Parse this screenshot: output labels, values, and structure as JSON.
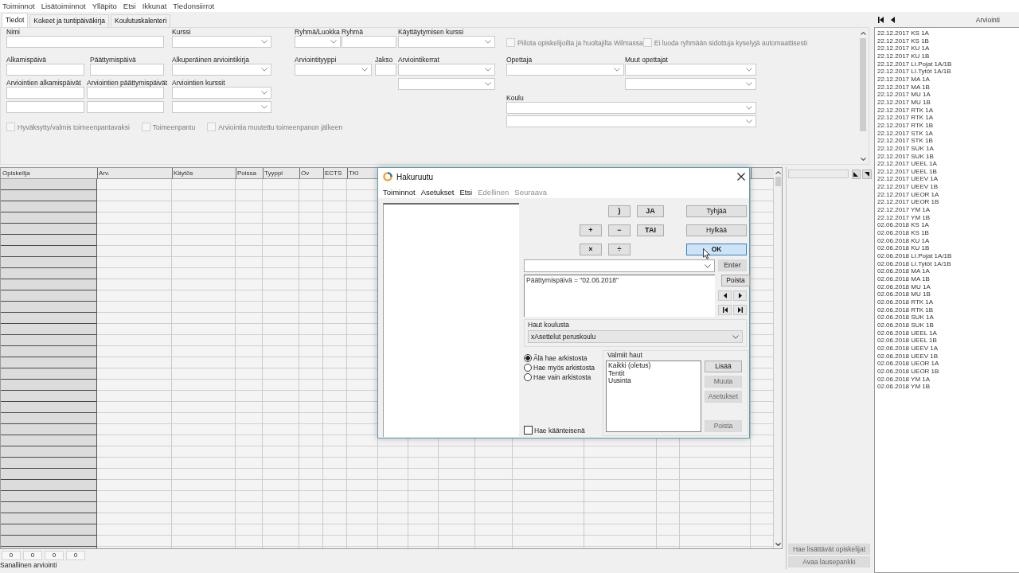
{
  "menu_bar": [
    "Toiminnot",
    "Lisätoiminnot",
    "Ylläpito",
    "Etsi",
    "Ikkunat",
    "Tiedonsiirrot"
  ],
  "tabs": [
    {
      "label": "Tiedot",
      "selected": true
    },
    {
      "label": "Kokeet ja tuntipäiväkirja",
      "selected": false
    },
    {
      "label": "Koulutuskalenteri",
      "selected": false
    }
  ],
  "form": {
    "fields": [
      {
        "label": "Nimi",
        "inputs": [
          {
            "kind": "text"
          }
        ]
      },
      {
        "label": "Kurssi",
        "inputs": [
          {
            "kind": "combo"
          }
        ]
      },
      {
        "label": "Ryhmä/Luokka",
        "inputs": [
          {
            "kind": "combo"
          }
        ]
      },
      {
        "label": "Ryhmä",
        "inputs": [
          {
            "kind": "text"
          }
        ]
      },
      {
        "label": "Käyttäytymisen kurssi",
        "inputs": [
          {
            "kind": "combo"
          }
        ]
      },
      {
        "label": "Alkamispäivä",
        "inputs": [
          {
            "kind": "text"
          }
        ]
      },
      {
        "label": "Päättymispäivä",
        "inputs": [
          {
            "kind": "text"
          }
        ]
      },
      {
        "label": "Alkuperäinen arviointikirja",
        "inputs": [
          {
            "kind": "combo"
          }
        ]
      },
      {
        "label": "Arviointityyppi",
        "inputs": [
          {
            "kind": "combo"
          }
        ]
      },
      {
        "label": "Jakso",
        "inputs": [
          {
            "kind": "text"
          }
        ]
      },
      {
        "label": "Arviointikerrat",
        "inputs": [
          {
            "kind": "combo"
          },
          {
            "kind": "combo"
          }
        ]
      },
      {
        "label": "Opettaja",
        "inputs": [
          {
            "kind": "combo"
          }
        ]
      },
      {
        "label": "Muut opettajat",
        "inputs": [
          {
            "kind": "combo"
          },
          {
            "kind": "combo"
          }
        ]
      },
      {
        "label": "Arviointien alkamispäivät",
        "inputs": [
          {
            "kind": "text"
          },
          {
            "kind": "text"
          }
        ]
      },
      {
        "label": "Arviointien päättymispäivät",
        "inputs": [
          {
            "kind": "text"
          },
          {
            "kind": "text"
          }
        ]
      },
      {
        "label": "Arviointien kurssit",
        "inputs": [
          {
            "kind": "combo"
          },
          {
            "kind": "combo"
          }
        ]
      },
      {
        "label": "Koulu",
        "inputs": [
          {
            "kind": "combo"
          },
          {
            "kind": "combo"
          }
        ]
      }
    ],
    "options": [
      {
        "label": "Piilota opiskelijoilta ja huoltajilta Wilmassa",
        "checked": false,
        "disabled": true
      },
      {
        "label": "Ei luoda ryhmään sidottuja kyselyjä automaattisesti",
        "checked": false,
        "disabled": true
      }
    ],
    "flags": [
      {
        "label": "Hyväksytty/valmis toimeenpantavaksi",
        "checked": false,
        "disabled": true
      },
      {
        "label": "Toimeenpantu",
        "checked": false,
        "disabled": true
      },
      {
        "label": "Arviointia muutettu toimeenpanon jälkeen",
        "checked": false,
        "disabled": true
      }
    ]
  },
  "table": {
    "columns": [
      "Opiskelija",
      "Arv.",
      "Käytös",
      "Poissa",
      "Tyyppi",
      "Ov",
      "ECTS",
      "TKI"
    ]
  },
  "counters": [
    "0",
    "0",
    "0",
    "0"
  ],
  "verbal_assessment_label": "Sanallinen arviointi",
  "side_panel": {
    "buttons": [
      {
        "label": "Hae lisättävät opiskelijat",
        "disabled": true
      },
      {
        "label": "Avaa lausepankki",
        "disabled": true
      }
    ]
  },
  "assessment_panel": {
    "title": "Arviointi",
    "items": [
      "22.12.2017 KS 1A",
      "22.12.2017 KS 1B",
      "22.12.2017 KU 1A",
      "22.12.2017 KU 1B",
      "22.12.2017 LI.Pojat 1A/1B",
      "22.12.2017 LI.Tytöt 1A/1B",
      "22.12.2017 MA 1A",
      "22.12.2017 MA 1B",
      "22.12.2017 MU 1A",
      "22.12.2017 MU 1B",
      "22.12.2017 RTK 1A",
      "22.12.2017 RTK 1A",
      "22.12.2017 RTK 1B",
      "22.12.2017 STK 1A",
      "22.12.2017 STK 1B",
      "22.12.2017 SUK 1A",
      "22.12.2017 SUK 1B",
      "22.12.2017 UEEL 1A",
      "22.12.2017 UEEL 1B",
      "22.12.2017 UEEV 1A",
      "22.12.2017 UEEV 1B",
      "22.12.2017 UEOR 1A",
      "22.12.2017 UEOR 1B",
      "22.12.2017 YM 1A",
      "22.12.2017 YM 1B",
      "02.06.2018 KS 1A",
      "02.06.2018 KS 1B",
      "02.06.2018 KU 1A",
      "02.06.2018 KU 1B",
      "02.06.2018 LI.Pojat 1A/1B",
      "02.06.2018 LI.Tytöt 1A/1B",
      "02.06.2018 MA 1A",
      "02.06.2018 MA 1B",
      "02.06.2018 MU 1A",
      "02.06.2018 MU 1B",
      "02.06.2018 RTK 1A",
      "02.06.2018 RTK 1B",
      "02.06.2018 SUK 1A",
      "02.06.2018 SUK 1B",
      "02.06.2018 UEEL 1A",
      "02.06.2018 UEEL 1B",
      "02.06.2018 UEEV 1A",
      "02.06.2018 UEEV 1B",
      "02.06.2018 UEOR 1A",
      "02.06.2018 UEOR 1B",
      "02.06.2018 YM 1A",
      "02.06.2018 YM 1B"
    ]
  },
  "search_dialog": {
    "title": "Hakuruutu",
    "menu": [
      {
        "label": "Toiminnot",
        "disabled": false
      },
      {
        "label": "Asetukset",
        "disabled": false
      },
      {
        "label": "Etsi",
        "disabled": false
      },
      {
        "label": "Edellinen",
        "disabled": true
      },
      {
        "label": "Seuraava",
        "disabled": true
      }
    ],
    "operators": [
      ")",
      "JA",
      "+",
      "−",
      "TAI",
      "×",
      "÷"
    ],
    "actions": [
      {
        "label": "Tyhjää",
        "highlighted": false
      },
      {
        "label": "Hylkää",
        "highlighted": false
      },
      {
        "label": "OK",
        "highlighted": true
      }
    ],
    "enter_button": {
      "label": "Enter",
      "disabled": true
    },
    "expression": "Päättymispäivä = \"02.06.2018\"",
    "delete_button": {
      "label": "Poista",
      "disabled": false
    },
    "school_searches": {
      "label": "Haut koulusta",
      "value": "xAsettelut peruskoulu"
    },
    "archive_options": [
      {
        "label": "Älä hae arkistosta",
        "selected": true
      },
      {
        "label": "Hae myös arkistosta",
        "selected": false
      },
      {
        "label": "Hae vain arkistosta",
        "selected": false
      }
    ],
    "saved_searches": {
      "label": "Valmiit haut",
      "items": [
        "Kaikki (oletus)",
        "Tentit",
        "Uusinta"
      ],
      "buttons": [
        {
          "label": "Lisää",
          "disabled": false
        },
        {
          "label": "Muuta",
          "disabled": true
        },
        {
          "label": "Asetukset",
          "disabled": true
        },
        {
          "label": "Poista",
          "disabled": true
        }
      ]
    },
    "invert_option": {
      "label": "Hae käänteisenä",
      "checked": false
    }
  }
}
